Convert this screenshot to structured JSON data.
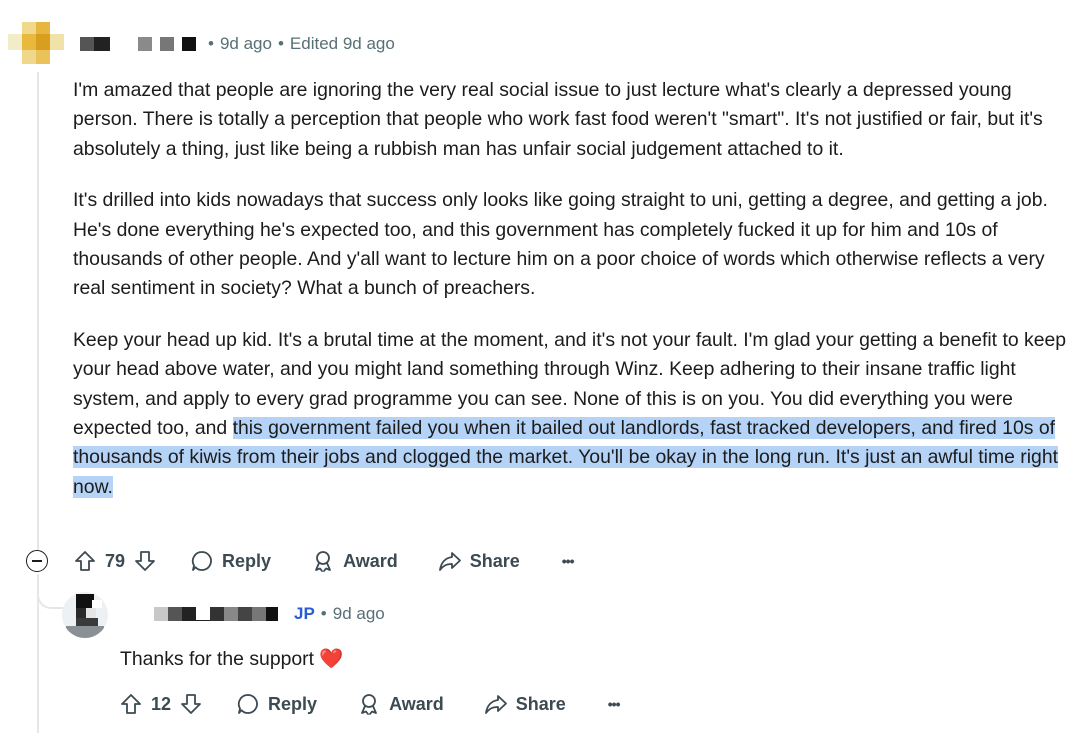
{
  "comment": {
    "meta": {
      "time": "9d ago",
      "edited": "Edited 9d ago",
      "separator": "•"
    },
    "paragraphs": [
      {
        "text": "I'm amazed that people are ignoring the very real social issue to just lecture what's clearly a depressed young person. There is totally a perception that people who work fast food weren't \"smart\". It's not justified or fair, but it's absolutely a thing, just like being a rubbish man has unfair social judgement attached to it."
      },
      {
        "text": "It's drilled into kids nowadays that success only looks like going straight to uni, getting a degree, and getting a job. He's done everything he's expected too, and this government has completely fucked it up for him and 10s of thousands of other people. And y'all want to lecture him on a poor choice of words which otherwise reflects a very real sentiment in society? What a bunch of preachers."
      },
      {
        "text": "Keep your head up kid. It's a brutal time at the moment, and it's not your fault. I'm glad your getting a benefit to keep your head above water, and you might land something through Winz. Keep adhering to their insane traffic light system, and apply to every grad programme you can see. None of this is on you. You did everything you were expected too, and ",
        "highlight": "this government failed you when it bailed out landlords, fast tracked developers, and fired 10s of thousands of kiwis from their jobs and clogged the market. You'll be okay in the long run. It's just an awful time right now."
      }
    ],
    "actions": {
      "votes": "79",
      "reply": "Reply",
      "award": "Award",
      "share": "Share",
      "more": "•••"
    }
  },
  "reply": {
    "meta": {
      "flair": "JP",
      "time": "9d ago",
      "separator": "•"
    },
    "text": "Thanks for the support ❤️",
    "actions": {
      "votes": "12",
      "reply": "Reply",
      "award": "Award",
      "share": "Share",
      "more": "•••"
    }
  },
  "colors": {
    "highlight": "#b4d3f7",
    "thread_line": "#e4e6e8",
    "flair": "#2a5bd7",
    "meta": "#576f76"
  }
}
